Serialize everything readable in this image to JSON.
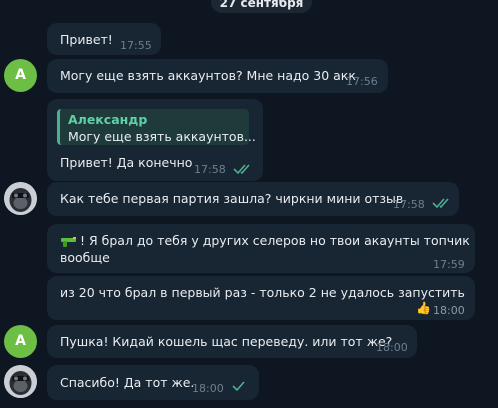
{
  "date_separator": "27 сентября",
  "messages": [
    {
      "text": "Привет!",
      "time": "17:55"
    },
    {
      "avatar_letter": "A",
      "text": "Могу еще взять аккаунтов? Мне надо 30 акк",
      "time": "17:56"
    },
    {
      "reply_author": "Александр",
      "reply_text": "Могу еще взять аккаунтов...",
      "text": "Привет! Да конечно",
      "time": "17:58"
    },
    {
      "avatar": "gorilla-avatar",
      "text": "Как тебе первая партия зашла? чиркни мини отзыв",
      "time": "17:58"
    },
    {
      "lines": [
        "! Я брал до тебя у других селеров но твои акаунты топчик",
        "вообще"
      ],
      "time": "17:59"
    },
    {
      "text": "из 20 что брал в первый раз  - только 2 не удалось запустить",
      "reaction": "👍",
      "time": "18:00"
    },
    {
      "avatar_letter": "A",
      "text": "Пушка! Кидай кошель щас переведу. или тот же?",
      "time": "18:00"
    },
    {
      "avatar": "gorilla-avatar",
      "text": "Спасибо! Да тот же.",
      "time": "18:00"
    }
  ],
  "colors": {
    "background": "#0e1621",
    "bubble": "#182533",
    "read_checks": "#4fae8e",
    "accent_avatar": "#6cbe45"
  }
}
